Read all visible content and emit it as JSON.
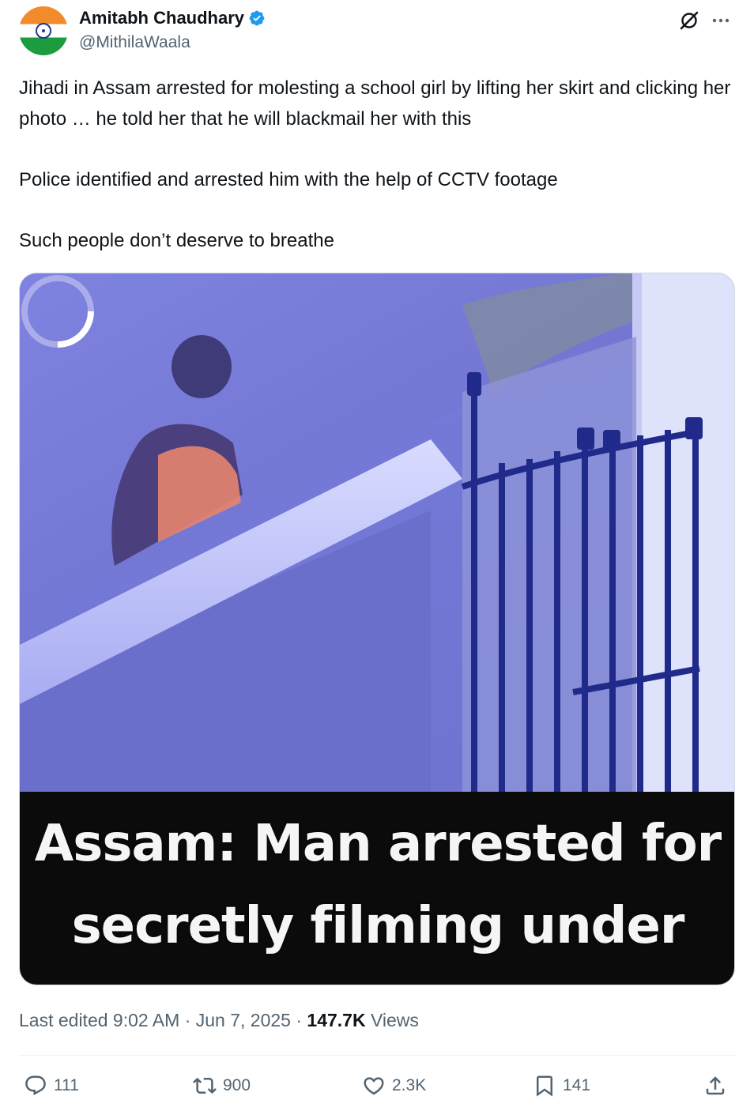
{
  "author": {
    "display_name": "Amitabh Chaudhary",
    "handle": "@MithilaWaala",
    "verified": true,
    "avatar_icon": "india-flag-avatar"
  },
  "header_actions": {
    "grok_icon": "grok-icon",
    "more_icon": "more-options-icon"
  },
  "tweet": {
    "paragraphs": [
      "Jihadi in Assam arrested for molesting a school girl by lifting her skirt and clicking her photo … he told her that he will blackmail her with this",
      "Police identified and arrested him with the help of CCTV footage",
      "Such people don’t deserve to breathe"
    ]
  },
  "media": {
    "type": "video",
    "state": "loading",
    "caption_line1": "Assam: Man arrested for",
    "caption_line2": "secretly filming under"
  },
  "meta": {
    "edited_prefix": "Last edited 9:02 AM · Jun 7, 2025 · ",
    "views_count": "147.7K",
    "views_label": " Views"
  },
  "actions": {
    "replies": "111",
    "reposts": "900",
    "likes": "2.3K",
    "bookmarks": "141"
  },
  "colors": {
    "text_primary": "#0f1419",
    "text_secondary": "#536471",
    "verified_blue": "#1d9bf0"
  }
}
